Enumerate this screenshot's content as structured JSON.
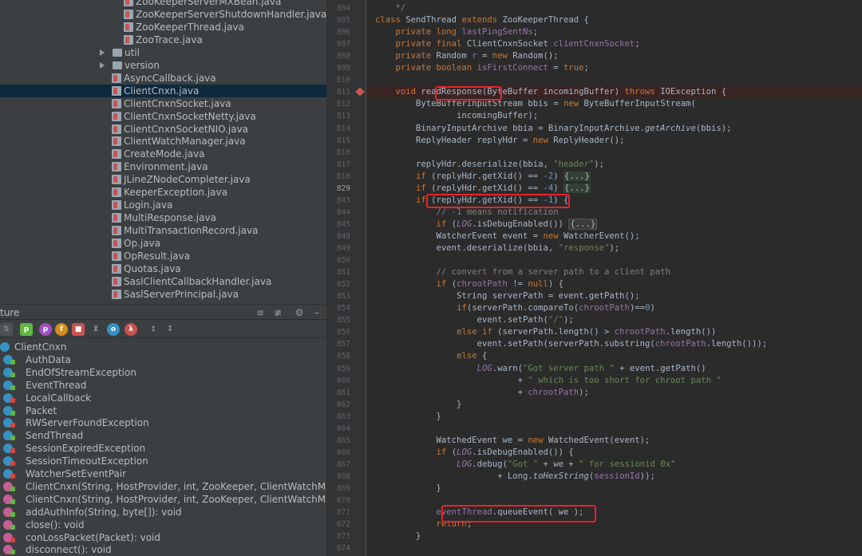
{
  "project_tree": {
    "files_top": [
      "ZooKeeperServerMXBean.java",
      "ZooKeeperServerShutdownHandler.java",
      "ZooKeeperThread.java",
      "ZooTrace.java"
    ],
    "folders": [
      "util",
      "version"
    ],
    "files": [
      "AsyncCallback.java",
      "ClientCnxn.java",
      "ClientCnxnSocket.java",
      "ClientCnxnSocketNetty.java",
      "ClientCnxnSocketNIO.java",
      "ClientWatchManager.java",
      "CreateMode.java",
      "Environment.java",
      "JLineZNodeCompleter.java",
      "KeeperException.java",
      "Login.java",
      "MultiResponse.java",
      "MultiTransactionRecord.java",
      "Op.java",
      "OpResult.java",
      "Quotas.java",
      "SaslClientCallbackHandler.java",
      "SaslServerPrincipal.java"
    ],
    "selected": "ClientCnxn.java"
  },
  "structure": {
    "title": "ture",
    "root": "ClientCnxn",
    "items": [
      {
        "label": "AuthData",
        "kind": "class",
        "access": "green"
      },
      {
        "label": "EndOfStreamException",
        "kind": "class",
        "access": "green"
      },
      {
        "label": "EventThread",
        "kind": "class",
        "access": "green"
      },
      {
        "label": "LocalCallback",
        "kind": "class",
        "access": "red"
      },
      {
        "label": "Packet",
        "kind": "class",
        "access": "green"
      },
      {
        "label": "RWServerFoundException",
        "kind": "class",
        "access": "red"
      },
      {
        "label": "SendThread",
        "kind": "class",
        "access": "green"
      },
      {
        "label": "SessionExpiredException",
        "kind": "class",
        "access": "red"
      },
      {
        "label": "SessionTimeoutException",
        "kind": "class",
        "access": "red"
      },
      {
        "label": "WatcherSetEventPair",
        "kind": "class",
        "access": "red"
      },
      {
        "label": "ClientCnxn(String, HostProvider, int, ZooKeeper, ClientWatchManager, C",
        "kind": "method",
        "access": "green"
      },
      {
        "label": "ClientCnxn(String, HostProvider, int, ZooKeeper, ClientWatchManager, C",
        "kind": "method",
        "access": "green"
      },
      {
        "label": "addAuthInfo(String, byte[]): void",
        "kind": "method",
        "access": "green"
      },
      {
        "label": "close(): void",
        "kind": "method",
        "access": "green"
      },
      {
        "label": "conLossPacket(Packet): void",
        "kind": "method",
        "access": "red"
      },
      {
        "label": "disconnect(): void",
        "kind": "method",
        "access": "green"
      }
    ]
  },
  "editor": {
    "breakpoint_line": "811",
    "current_line": "829",
    "lines": [
      {
        "n": "804",
        "html": "    <span class='cmt'>*/</span>"
      },
      {
        "n": "805",
        "html": "<span class='kw'>class</span> SendThread <span class='kw'>extends</span> ZooKeeperThread {"
      },
      {
        "n": "806",
        "html": "    <span class='kw'>private long</span> <span class='fld'>lastPingSentNs</span>;"
      },
      {
        "n": "807",
        "html": "    <span class='kw'>private final</span> ClientCnxnSocket <span class='fld'>clientCnxnSocket</span>;"
      },
      {
        "n": "808",
        "html": "    <span class='kw'>private</span> Random <span class='fld'>r</span> = <span class='kw'>new</span> Random();"
      },
      {
        "n": "809",
        "html": "    <span class='kw'>private boolean</span> <span class='fld'>isFirstConnect</span> = <span class='kw'>true</span>;"
      },
      {
        "n": "810",
        "html": ""
      },
      {
        "n": "811",
        "html": "    <span class='kw'>void</span> readResponse(ByteBuffer incomingBuffer) <span class='kw'>throws</span> IOException {",
        "hl": true
      },
      {
        "n": "812",
        "html": "        ByteBufferInputStream bbis = <span class='kw'>new</span> ByteBufferInputStream("
      },
      {
        "n": "813",
        "html": "                incomingBuffer);"
      },
      {
        "n": "814",
        "html": "        BinaryInputArchive bbia = BinaryInputArchive.<i>getArchive</i>(bbis);"
      },
      {
        "n": "815",
        "html": "        ReplyHeader replyHdr = <span class='kw'>new</span> ReplyHeader();"
      },
      {
        "n": "816",
        "html": ""
      },
      {
        "n": "817",
        "html": "        replyHdr.deserialize(bbia, <span class='str'>\"header\"</span>);"
      },
      {
        "n": "818",
        "html": "        <span class='kw'>if</span> (replyHdr.getXid() == <span class='num'>-2</span>) <span class='fold-box'>{...}</span>"
      },
      {
        "n": "829",
        "html": "        <span class='kw'>if</span> (replyHdr.getXid() == <span class='num'>-4</span>) <span class='fold-box'>{...}</span>"
      },
      {
        "n": "843",
        "html": "        <span class='kw'>if</span> (replyHdr.getXid() == <span class='num'>-1</span>) {"
      },
      {
        "n": "844",
        "html": "            <span class='cmt'>// -1 means notification</span>"
      },
      {
        "n": "845",
        "html": "            <span class='kw'>if</span> (<span class='fld'><i>LOG</i></span>.isDebugEnabled()) <span class='fold-box2'>{...}</span>"
      },
      {
        "n": "848",
        "html": "            WatcherEvent event = <span class='kw'>new</span> WatcherEvent();"
      },
      {
        "n": "849",
        "html": "            event.deserialize(bbia, <span class='str'>\"response\"</span>);"
      },
      {
        "n": "850",
        "html": ""
      },
      {
        "n": "851",
        "html": "            <span class='cmt'>// convert from a server path to a client path</span>"
      },
      {
        "n": "852",
        "html": "            <span class='kw'>if</span> (<span class='fld'>chrootPath</span> != <span class='kw'>null</span>) {"
      },
      {
        "n": "853",
        "html": "                String serverPath = event.getPath();"
      },
      {
        "n": "854",
        "html": "                <span class='kw'>if</span>(serverPath.compareTo(<span class='fld'>chrootPath</span>)==<span class='num'>0</span>)"
      },
      {
        "n": "855",
        "html": "                    event.setPath(<span class='str'>\"/\"</span>);"
      },
      {
        "n": "856",
        "html": "                <span class='kw'>else if</span> (serverPath.length() > <span class='fld'>chrootPath</span>.length())"
      },
      {
        "n": "857",
        "html": "                    event.setPath(serverPath.substring(<span class='fld'>chrootPath</span>.length()));"
      },
      {
        "n": "858",
        "html": "                <span class='kw'>else</span> {"
      },
      {
        "n": "859",
        "html": "                    <span class='fld'><i>LOG</i></span>.warn(<span class='str'>\"Got server path \"</span> + event.getPath()"
      },
      {
        "n": "860",
        "html": "                            + <span class='str'>\" which is too short for chroot path \"</span>"
      },
      {
        "n": "861",
        "html": "                            + <span class='fld'>chrootPath</span>);"
      },
      {
        "n": "862",
        "html": "                }"
      },
      {
        "n": "863",
        "html": "            }"
      },
      {
        "n": "864",
        "html": ""
      },
      {
        "n": "865",
        "html": "            WatchedEvent we = <span class='kw'>new</span> WatchedEvent(event);"
      },
      {
        "n": "866",
        "html": "            <span class='kw'>if</span> (<span class='fld'><i>LOG</i></span>.isDebugEnabled()) {"
      },
      {
        "n": "867",
        "html": "                <span class='fld'><i>LOG</i></span>.debug(<span class='str'>\"Got \"</span> + we + <span class='str'>\" for sessionid 0x\"</span>"
      },
      {
        "n": "868",
        "html": "                        + Long.<i>toHexString</i>(<span class='fld'>sessionId</span>));"
      },
      {
        "n": "869",
        "html": "            }"
      },
      {
        "n": "870",
        "html": ""
      },
      {
        "n": "871",
        "html": "            <span class='fld'>eventThread</span>.queueEvent( we );"
      },
      {
        "n": "872",
        "html": "            <span class='kw'>return</span>;"
      },
      {
        "n": "873",
        "html": "        }"
      },
      {
        "n": "874",
        "html": ""
      }
    ]
  }
}
